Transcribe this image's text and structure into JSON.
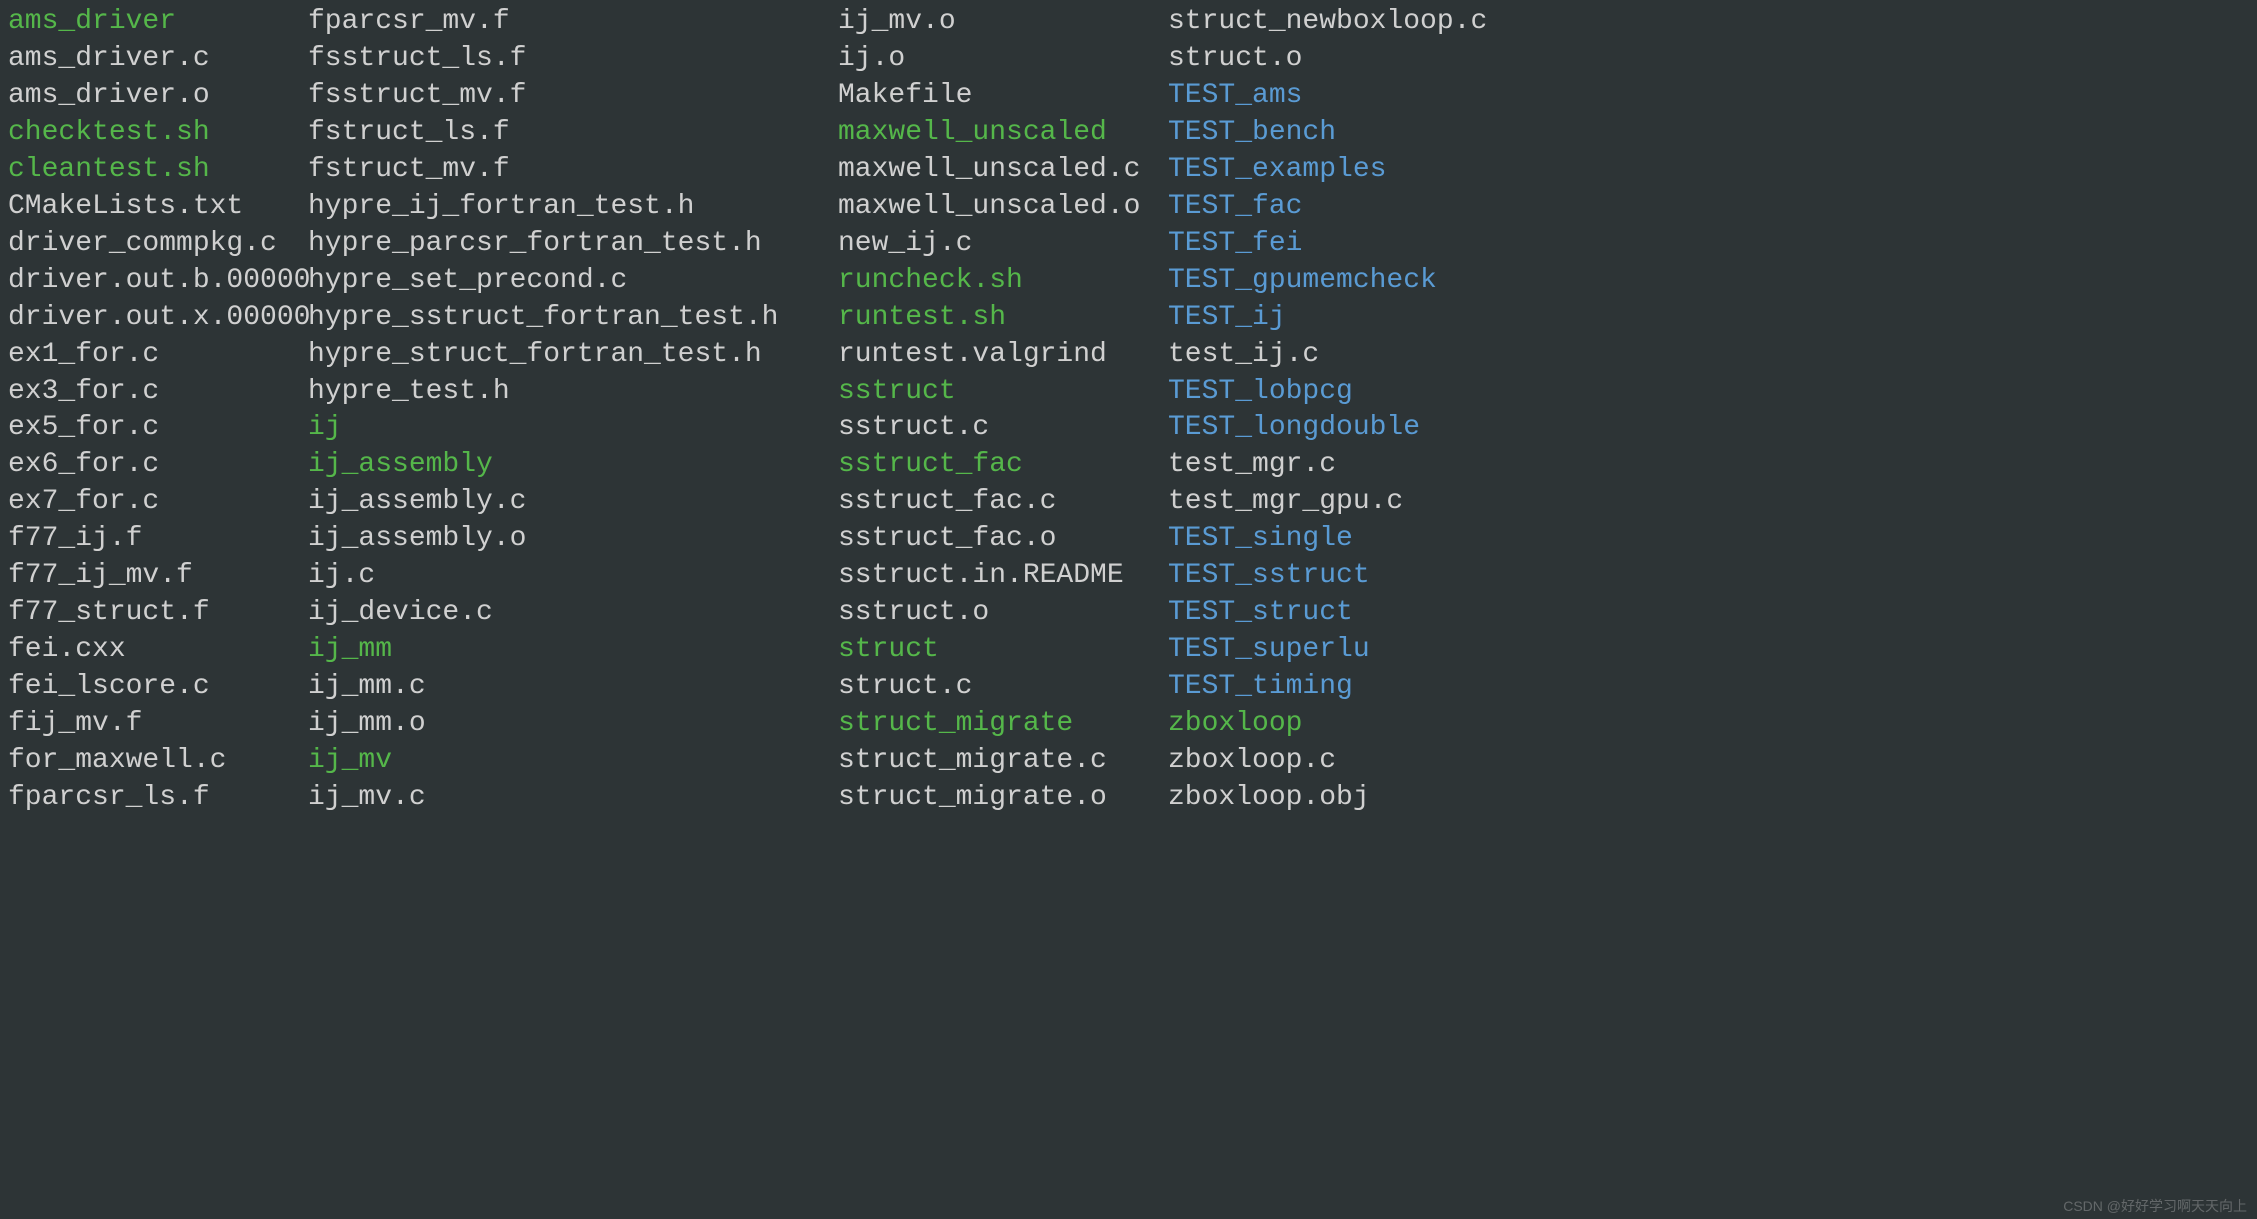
{
  "colors": {
    "background": "#2d3436",
    "plain": "#d0d0d0",
    "executable": "#55b74a",
    "directory": "#5a9bd4"
  },
  "watermark": "CSDN @好好学习啊天天向上",
  "listing": {
    "columns": [
      [
        {
          "name": "ams_driver",
          "kind": "green"
        },
        {
          "name": "ams_driver.c",
          "kind": "plain"
        },
        {
          "name": "ams_driver.o",
          "kind": "plain"
        },
        {
          "name": "checktest.sh",
          "kind": "green"
        },
        {
          "name": "cleantest.sh",
          "kind": "green"
        },
        {
          "name": "CMakeLists.txt",
          "kind": "plain"
        },
        {
          "name": "driver_commpkg.c",
          "kind": "plain"
        },
        {
          "name": "driver.out.b.00000",
          "kind": "plain"
        },
        {
          "name": "driver.out.x.00000",
          "kind": "plain"
        },
        {
          "name": "ex1_for.c",
          "kind": "plain"
        },
        {
          "name": "ex3_for.c",
          "kind": "plain"
        },
        {
          "name": "ex5_for.c",
          "kind": "plain"
        },
        {
          "name": "ex6_for.c",
          "kind": "plain"
        },
        {
          "name": "ex7_for.c",
          "kind": "plain"
        },
        {
          "name": "f77_ij.f",
          "kind": "plain"
        },
        {
          "name": "f77_ij_mv.f",
          "kind": "plain"
        },
        {
          "name": "f77_struct.f",
          "kind": "plain"
        },
        {
          "name": "fei.cxx",
          "kind": "plain"
        },
        {
          "name": "fei_lscore.c",
          "kind": "plain"
        },
        {
          "name": "fij_mv.f",
          "kind": "plain"
        },
        {
          "name": "for_maxwell.c",
          "kind": "plain"
        },
        {
          "name": "fparcsr_ls.f",
          "kind": "plain"
        }
      ],
      [
        {
          "name": "fparcsr_mv.f",
          "kind": "plain"
        },
        {
          "name": "fsstruct_ls.f",
          "kind": "plain"
        },
        {
          "name": "fsstruct_mv.f",
          "kind": "plain"
        },
        {
          "name": "fstruct_ls.f",
          "kind": "plain"
        },
        {
          "name": "fstruct_mv.f",
          "kind": "plain"
        },
        {
          "name": "hypre_ij_fortran_test.h",
          "kind": "plain"
        },
        {
          "name": "hypre_parcsr_fortran_test.h",
          "kind": "plain"
        },
        {
          "name": "hypre_set_precond.c",
          "kind": "plain"
        },
        {
          "name": "hypre_sstruct_fortran_test.h",
          "kind": "plain"
        },
        {
          "name": "hypre_struct_fortran_test.h",
          "kind": "plain"
        },
        {
          "name": "hypre_test.h",
          "kind": "plain"
        },
        {
          "name": "ij",
          "kind": "green"
        },
        {
          "name": "ij_assembly",
          "kind": "green"
        },
        {
          "name": "ij_assembly.c",
          "kind": "plain"
        },
        {
          "name": "ij_assembly.o",
          "kind": "plain"
        },
        {
          "name": "ij.c",
          "kind": "plain"
        },
        {
          "name": "ij_device.c",
          "kind": "plain"
        },
        {
          "name": "ij_mm",
          "kind": "green"
        },
        {
          "name": "ij_mm.c",
          "kind": "plain"
        },
        {
          "name": "ij_mm.o",
          "kind": "plain"
        },
        {
          "name": "ij_mv",
          "kind": "green"
        },
        {
          "name": "ij_mv.c",
          "kind": "plain"
        }
      ],
      [
        {
          "name": "ij_mv.o",
          "kind": "plain"
        },
        {
          "name": "ij.o",
          "kind": "plain"
        },
        {
          "name": "Makefile",
          "kind": "plain"
        },
        {
          "name": "maxwell_unscaled",
          "kind": "green"
        },
        {
          "name": "maxwell_unscaled.c",
          "kind": "plain"
        },
        {
          "name": "maxwell_unscaled.o",
          "kind": "plain"
        },
        {
          "name": "new_ij.c",
          "kind": "plain"
        },
        {
          "name": "runcheck.sh",
          "kind": "green"
        },
        {
          "name": "runtest.sh",
          "kind": "green"
        },
        {
          "name": "runtest.valgrind",
          "kind": "plain"
        },
        {
          "name": "sstruct",
          "kind": "green"
        },
        {
          "name": "sstruct.c",
          "kind": "plain"
        },
        {
          "name": "sstruct_fac",
          "kind": "green"
        },
        {
          "name": "sstruct_fac.c",
          "kind": "plain"
        },
        {
          "name": "sstruct_fac.o",
          "kind": "plain"
        },
        {
          "name": "sstruct.in.README",
          "kind": "plain"
        },
        {
          "name": "sstruct.o",
          "kind": "plain"
        },
        {
          "name": "struct",
          "kind": "green"
        },
        {
          "name": "struct.c",
          "kind": "plain"
        },
        {
          "name": "struct_migrate",
          "kind": "green"
        },
        {
          "name": "struct_migrate.c",
          "kind": "plain"
        },
        {
          "name": "struct_migrate.o",
          "kind": "plain"
        }
      ],
      [
        {
          "name": "struct_newboxloop.c",
          "kind": "plain"
        },
        {
          "name": "struct.o",
          "kind": "plain"
        },
        {
          "name": "TEST_ams",
          "kind": "blue"
        },
        {
          "name": "TEST_bench",
          "kind": "blue"
        },
        {
          "name": "TEST_examples",
          "kind": "blue"
        },
        {
          "name": "TEST_fac",
          "kind": "blue"
        },
        {
          "name": "TEST_fei",
          "kind": "blue"
        },
        {
          "name": "TEST_gpumemcheck",
          "kind": "blue"
        },
        {
          "name": "TEST_ij",
          "kind": "blue"
        },
        {
          "name": "test_ij.c",
          "kind": "plain"
        },
        {
          "name": "TEST_lobpcg",
          "kind": "blue"
        },
        {
          "name": "TEST_longdouble",
          "kind": "blue"
        },
        {
          "name": "test_mgr.c",
          "kind": "plain"
        },
        {
          "name": "test_mgr_gpu.c",
          "kind": "plain"
        },
        {
          "name": "TEST_single",
          "kind": "blue"
        },
        {
          "name": "TEST_sstruct",
          "kind": "blue"
        },
        {
          "name": "TEST_struct",
          "kind": "blue"
        },
        {
          "name": "TEST_superlu",
          "kind": "blue"
        },
        {
          "name": "TEST_timing",
          "kind": "blue"
        },
        {
          "name": "zboxloop",
          "kind": "green"
        },
        {
          "name": "zboxloop.c",
          "kind": "plain"
        },
        {
          "name": "zboxloop.obj",
          "kind": "plain"
        }
      ]
    ]
  }
}
